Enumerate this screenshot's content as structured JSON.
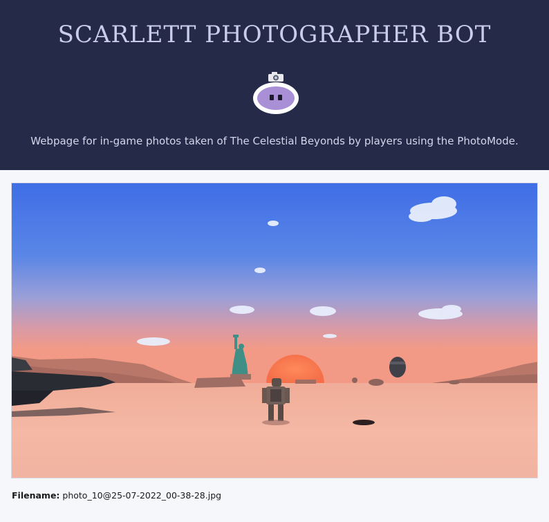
{
  "header": {
    "title": "SCARLETT PHOTOGRAPHER BOT",
    "logo_icon": "robot-camera-icon",
    "tagline": "Webpage for in-game photos taken of The Celestial Beyonds by players using the PhotoMode."
  },
  "colors": {
    "header_bg": "#252a48",
    "page_bg": "#f6f7fb",
    "title_text": "#c9cdea",
    "logo_body": "#a98fd6"
  },
  "gallery": {
    "photos": [
      {
        "image_icon": "in-game-screenshot",
        "filename_label": "Filename:",
        "filename_value": "photo_10@25-07-2022_00-38-28.jpg"
      }
    ]
  }
}
